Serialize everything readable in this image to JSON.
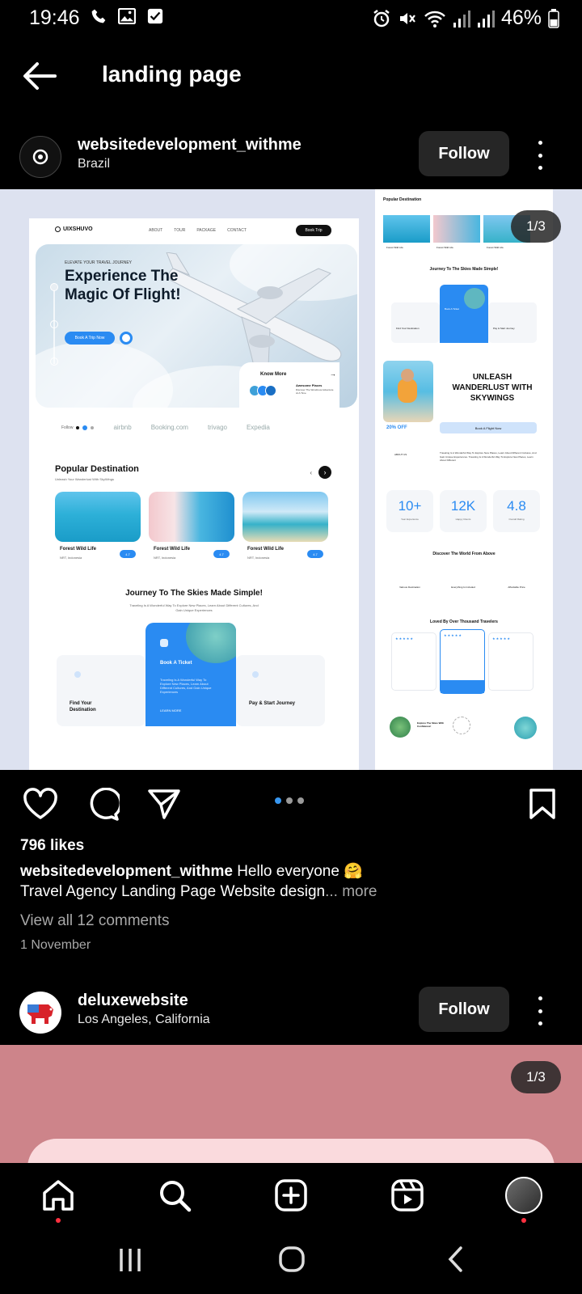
{
  "status_bar": {
    "time": "19:46",
    "battery": "46%",
    "left_icons": [
      "phone-icon",
      "image-icon",
      "checkbox-icon"
    ],
    "right_icons": [
      "alarm-icon",
      "mute-icon",
      "wifi-icon",
      "signal-icon",
      "signal-icon",
      "battery-icon"
    ]
  },
  "header": {
    "title": "landing page",
    "back_icon": "back-arrow-icon"
  },
  "post1": {
    "username": "websitedevelopment_withme",
    "location": "Brazil",
    "follow_label": "Follow",
    "carousel_counter": "1/3",
    "carousel_dots": 3,
    "carousel_active": 0,
    "likes": "796 likes",
    "caption_user": "websitedevelopment_withme",
    "caption_text": "Hello everyone 🤗",
    "caption_line2": "Travel Agency Landing Page Website design",
    "more_label": "... more",
    "comments_label": "View all 12 comments",
    "date": "1 November",
    "mockup_left": {
      "logo": "UIXSHUVO",
      "nav": [
        "ABOUT",
        "TOUR",
        "PACKAGE",
        "CONTACT"
      ],
      "book_trip": "Book Trip",
      "hero_eyebrow": "ELEVATE YOUR TRAVEL JOURNEY",
      "hero_title": "Experience The Magic Of Flight!",
      "hero_button": "Book A Trip Now",
      "know_more": "Know More",
      "know_sub_title": "Awesome Places",
      "know_sub_text": "Discover The Wondrous Adventure At A Time",
      "follow_label": "Follow",
      "partners": [
        "airbnb",
        "Booking.com",
        "trivago",
        "Expedia"
      ],
      "popular_title": "Popular Destination",
      "popular_sub": "Unleash Your Wanderlust With SkyWings",
      "cards": [
        {
          "title": "Forest Wild Life",
          "location": "NRT, Indonesia",
          "rating": "4.7"
        },
        {
          "title": "Forest Wild Life",
          "location": "NRT, Indonesia",
          "rating": "4.7"
        },
        {
          "title": "Forest Wild Life",
          "location": "NRT, Indonesia",
          "rating": "4.7"
        }
      ],
      "journey_title": "Journey To The Skies Made Simple!",
      "journey_sub": "Traveling Is A Wonderful Way To Explore New Places, Learn About Different Cultures, And Gain Unique Experiences",
      "step_left": "Find Your Destination",
      "step_mid_title": "Book A Ticket",
      "step_mid_text": "Traveling Is A Wonderful Way To Explore New Places, Learn About Different Cultures, And Gain Unique Experiences",
      "step_mid_link": "LEARN MORE",
      "step_right": "Pay & Start Journey"
    },
    "mockup_right": {
      "popular_title": "Popular Destination",
      "card_titles": [
        "Forest Wild Life",
        "Forest Wild Life",
        "Forest Wild Life"
      ],
      "journey_title": "Journey To The Skies Made Simple!",
      "step_mid": "Book A Ticket",
      "step_left": "Find Your Destination",
      "step_right": "Pay & Start Journey",
      "unleash_title": "UNLEASH WANDERLUST WITH SKYWINGS",
      "discount": "20% OFF",
      "book_flight": "Book A Flight Now",
      "about_label": "ABOUT US",
      "about_title": "Traveling Is A Wonderful Way To Explore New Places, Learn About Different Cultures, And Gain Unique Experiences. Traveling Is A Wonderful Way To Explore New Places, Learn About Different",
      "stats": [
        {
          "value": "10+",
          "label": "Year Experience"
        },
        {
          "value": "12K",
          "label": "Happy Clients"
        },
        {
          "value": "4.8",
          "label": "Overall Rating"
        }
      ],
      "discover_title": "Discover The World From Above",
      "features": [
        "Various Destination",
        "Everything Is Included",
        "Affordable Price"
      ],
      "reviews_title": "Loved By Over Thousand Travelers",
      "explore": "Explore The Skies With Confidence!"
    }
  },
  "post2": {
    "username": "deluxewebsite",
    "location": "Los Angeles, California",
    "follow_label": "Follow",
    "carousel_counter": "1/3"
  },
  "bottom_nav": {
    "items": [
      "home-icon",
      "search-icon",
      "create-icon",
      "reels-icon",
      "profile-avatar"
    ]
  },
  "colors": {
    "accent_blue": "#2a8bf2",
    "dot_active": "#3897f0",
    "notification_red": "#ff3040",
    "post2_bg": "#cd848a"
  }
}
